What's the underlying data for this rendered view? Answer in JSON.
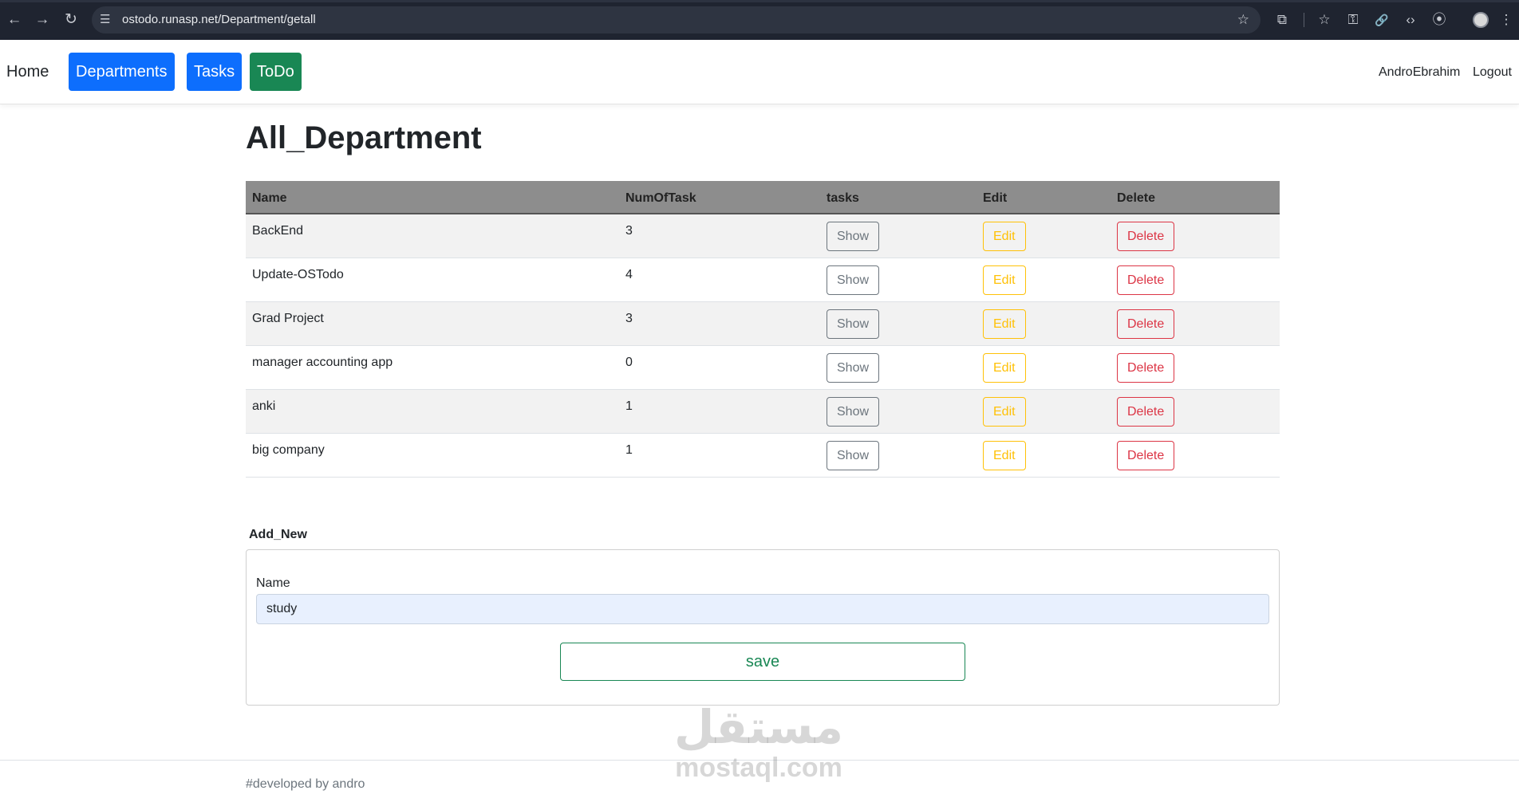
{
  "browser": {
    "url": "ostodo.runasp.net/Department/getall",
    "icons": {
      "back": "←",
      "forward": "→",
      "reload": "↻",
      "site": "☰",
      "star": "☆",
      "extensions": "⧉",
      "bookmark": "☆",
      "key": "⚿",
      "link": "🔗",
      "code": "‹›",
      "capture": "⦿",
      "menu": "⋮"
    }
  },
  "nav": {
    "home": "Home",
    "departments": "Departments",
    "tasks": "Tasks",
    "todo": "ToDo",
    "user": "AndroEbrahim",
    "logout": "Logout",
    "colors": {
      "departments": "#0d6efd",
      "tasks": "#0d6efd",
      "todo": "#198754"
    }
  },
  "page": {
    "title": "All_Department"
  },
  "table": {
    "headers": [
      "Name",
      "NumOfTask",
      "tasks",
      "Edit",
      "Delete"
    ],
    "rows": [
      {
        "name": "BackEnd",
        "num": "3"
      },
      {
        "name": "Update-OSTodo",
        "num": "4"
      },
      {
        "name": "Grad Project",
        "num": "3"
      },
      {
        "name": "manager accounting app",
        "num": "0"
      },
      {
        "name": "anki",
        "num": "1"
      },
      {
        "name": "big company",
        "num": "1"
      }
    ],
    "show_label": "Show",
    "edit_label": "Edit",
    "delete_label": "Delete"
  },
  "add_new": {
    "title": "Add_New",
    "name_label": "Name",
    "name_value": "study",
    "save_label": "save"
  },
  "footer": {
    "text": "#developed by andro"
  },
  "watermark": {
    "logo": "مستقل",
    "text": "mostaql.com"
  }
}
